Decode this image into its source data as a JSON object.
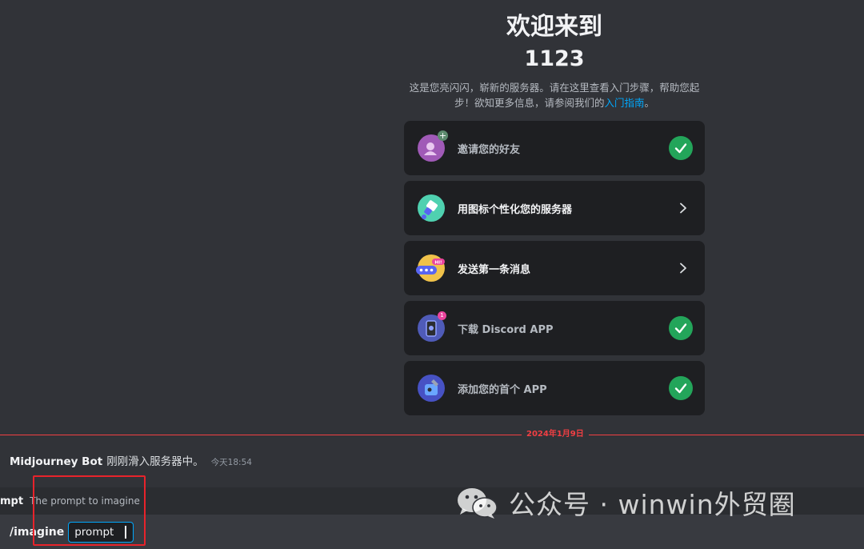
{
  "welcome": {
    "title": "欢迎来到",
    "server_name": "1123",
    "desc_main": "这是您亮闪闪，崭新的服务器。请在这里查看入门步骤，帮助您起步！欲知更多信息，请参阅我们的",
    "desc_link": "入门指南",
    "desc_end": "。"
  },
  "checklist": [
    {
      "label": "邀请您的好友",
      "status": "done",
      "icon": "invite-friends-icon"
    },
    {
      "label": "用图标个性化您的服务器",
      "status": "todo",
      "icon": "personalize-icon"
    },
    {
      "label": "发送第一条消息",
      "status": "todo",
      "icon": "message-icon"
    },
    {
      "label": "下载 Discord APP",
      "status": "done",
      "icon": "download-app-icon"
    },
    {
      "label": "添加您的首个 APP",
      "status": "done",
      "icon": "add-app-icon"
    }
  ],
  "divider": {
    "date": "2024年1月9日"
  },
  "join_message": {
    "bot_name": "Midjourney Bot",
    "text": "刚刚滑入服务器中。",
    "timestamp": "今天18:54"
  },
  "option_hint": {
    "option": "mpt",
    "description": "The prompt to imagine"
  },
  "command": {
    "name": "/imagine",
    "param": "prompt"
  },
  "watermark": {
    "text": "公众号 · winwin外贸圈"
  },
  "colors": {
    "background": "#313338",
    "card": "#1e1f22",
    "success": "#23a55a",
    "new_divider": "#f23f43",
    "link": "#00a8fc",
    "annotation": "#e8232b"
  }
}
